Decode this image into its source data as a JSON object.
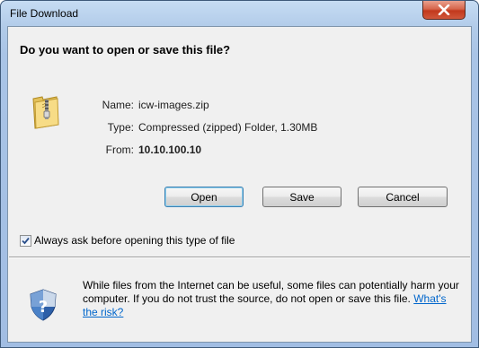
{
  "window": {
    "title": "File Download"
  },
  "dialog": {
    "question": "Do you want to open or save this file?",
    "file": {
      "name_label": "Name:",
      "name_value": "icw-images.zip",
      "type_label": "Type:",
      "type_value": "Compressed (zipped) Folder, 1.30MB",
      "from_label": "From:",
      "from_value": "10.10.100.10"
    },
    "buttons": {
      "open": "Open",
      "save": "Save",
      "cancel": "Cancel"
    },
    "checkbox": {
      "label": "Always ask before opening this type of file",
      "checked": true
    },
    "warning": {
      "text": "While files from the Internet can be useful, some files can potentially harm your computer. If you do not trust the source, do not open or save this file.",
      "link": "What's the risk?"
    }
  },
  "icons": {
    "file": "zip-folder-icon",
    "security": "security-shield-icon",
    "close": "close-icon",
    "check": "checkmark-icon"
  },
  "colors": {
    "link": "#0066cc",
    "close_button": "#c2391d",
    "frame": "#a9c4e6"
  }
}
